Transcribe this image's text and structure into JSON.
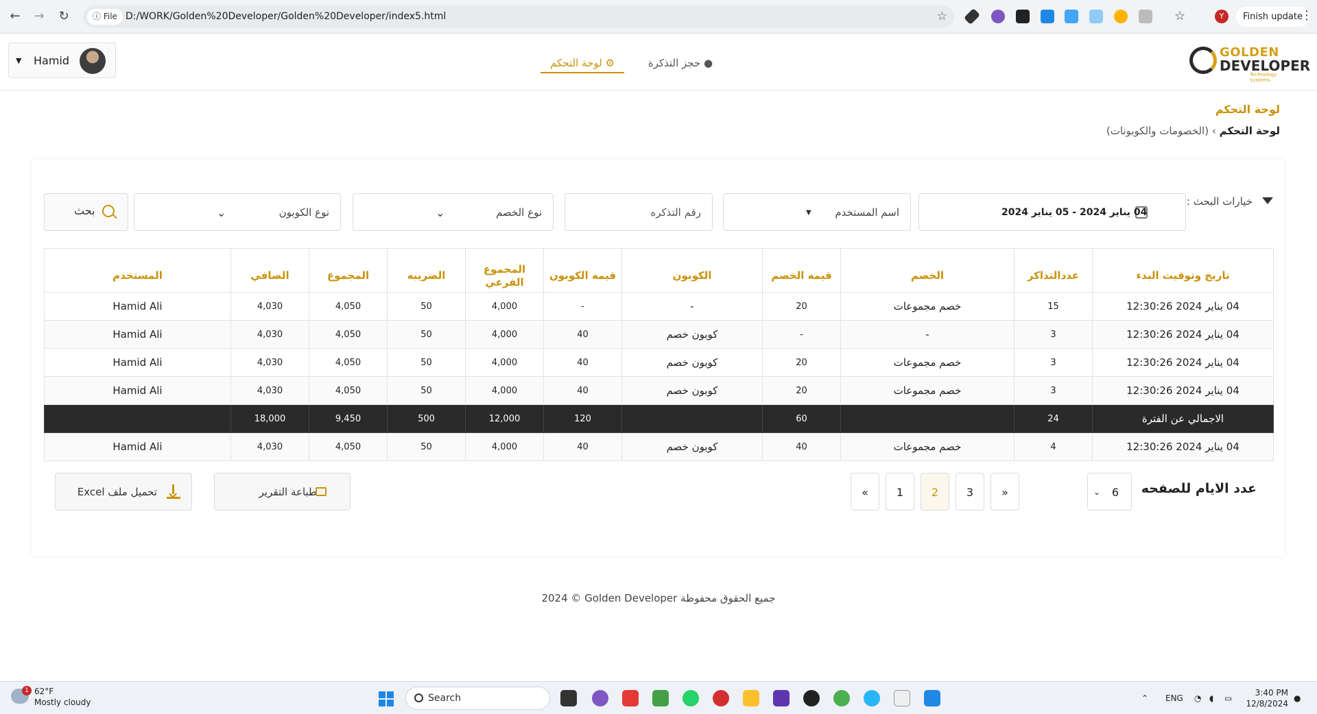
{
  "browser": {
    "chip_label": "File",
    "url": "D:/WORK/Golden%20Developer/Golden%20Developer/index5.html",
    "profile_initial": "Y",
    "update_label": "Finish update"
  },
  "header": {
    "logo_line1": "GOLDEN",
    "logo_line2": "DEVELOPER",
    "logo_tagline": "Technology Systems",
    "tabs": [
      {
        "label": "لوحة التحكم",
        "active": true
      },
      {
        "label": "حجز التذكرة",
        "active": false
      }
    ],
    "user_name": "Hamid"
  },
  "page": {
    "title": "لوحة التحكم",
    "breadcrumb_root": "لوحة التحكم",
    "breadcrumb_sep": "›",
    "breadcrumb_current": "(الخصومات والكوبونات)"
  },
  "filters": {
    "label": "خيارات البحث :",
    "date_range": "04 يناير 2024 - 05 يناير 2024",
    "user_placeholder": "اسم المستخدم",
    "ticket_placeholder": "رقم التذكره",
    "discount_type_placeholder": "نوع الخصم",
    "coupon_type_placeholder": "نوع الكوبون",
    "search_label": "بحث"
  },
  "table": {
    "headers": [
      "تاريخ وتوقيت البدء",
      "عددالتذاكر",
      "الخصم",
      "قيمه الخصم",
      "الكوبون",
      "قيمه الكوبون",
      "المجموع الفرعي",
      "الضريبه",
      "المجموع",
      "الصافي",
      "المستخدم"
    ],
    "rows": [
      [
        "04 يناير 2024 12:30:26",
        "15",
        "خصم مجموعات",
        "20",
        "-",
        "-",
        "4,000",
        "50",
        "4,050",
        "4,030",
        "Hamid Ali"
      ],
      [
        "04 يناير 2024 12:30:26",
        "3",
        "-",
        "-",
        "كوبون خصم",
        "40",
        "4,000",
        "50",
        "4,050",
        "4,030",
        "Hamid Ali"
      ],
      [
        "04 يناير 2024 12:30:26",
        "3",
        "خصم مجموعات",
        "20",
        "كوبون خصم",
        "40",
        "4,000",
        "50",
        "4,050",
        "4,030",
        "Hamid Ali"
      ],
      [
        "04 يناير 2024 12:30:26",
        "3",
        "خصم مجموعات",
        "20",
        "كوبون خصم",
        "40",
        "4,000",
        "50",
        "4,050",
        "4,030",
        "Hamid Ali"
      ]
    ],
    "total_row": [
      "الاجمالي عن الفترة",
      "24",
      "",
      "60",
      "",
      "120",
      "12,000",
      "500",
      "9,450",
      "18,000",
      ""
    ],
    "last_row": [
      "04 يناير 2024 12:30:26",
      "4",
      "خصم مجموعات",
      "40",
      "كوبون خصم",
      "40",
      "4,000",
      "50",
      "4,050",
      "4,030",
      "Hamid Ali"
    ]
  },
  "pagination": {
    "per_page_label": "عدد الايام للصفحه",
    "per_page_value": "6",
    "prev": "«",
    "pages": [
      "3",
      "2",
      "1"
    ],
    "active_page": "2",
    "next": "»"
  },
  "actions": {
    "print_label": "طباعة التقرير",
    "excel_label": "تحميل ملف Excel"
  },
  "footer": {
    "copyright": "2024 © Golden Developer جميع الحقوق محفوظة"
  },
  "taskbar": {
    "weather_temp": "62°F",
    "weather_desc": "Mostly cloudy",
    "weather_badge": "1",
    "search_label": "Search",
    "lang": "ENG",
    "time": "3:40 PM",
    "date": "12/8/2024"
  }
}
